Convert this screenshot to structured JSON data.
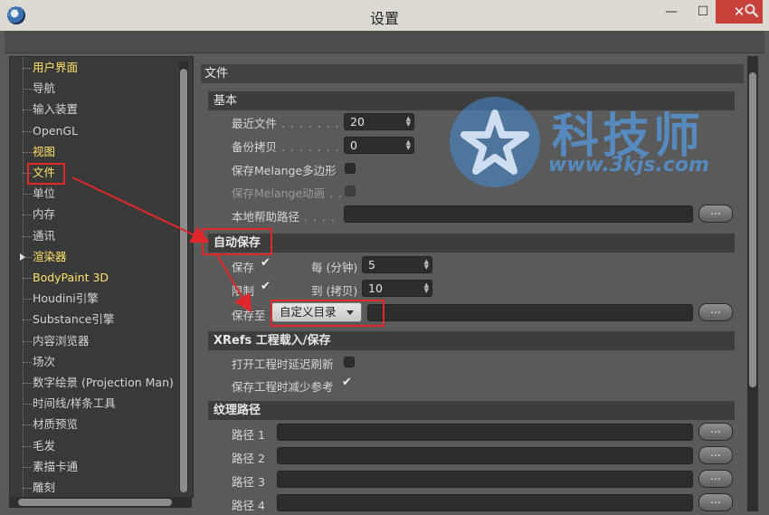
{
  "window": {
    "title": "设置",
    "min_glyph": "—",
    "max_glyph": "☐",
    "close_glyph": "✕"
  },
  "nav": {
    "items": [
      {
        "label": "用户界面",
        "highlight": true
      },
      {
        "label": "导航",
        "highlight": false
      },
      {
        "label": "输入装置",
        "highlight": false
      },
      {
        "label": "OpenGL",
        "highlight": false
      },
      {
        "label": "视图",
        "highlight": true
      },
      {
        "label": "文件",
        "highlight": true
      },
      {
        "label": "单位",
        "highlight": false
      },
      {
        "label": "内存",
        "highlight": false
      },
      {
        "label": "通讯",
        "highlight": false
      },
      {
        "label": "渲染器",
        "highlight": true,
        "expandable": true
      },
      {
        "label": "BodyPaint 3D",
        "highlight": true
      },
      {
        "label": "Houdini引擎",
        "highlight": false
      },
      {
        "label": "Substance引擎",
        "highlight": false
      },
      {
        "label": "内容浏览器",
        "highlight": false
      },
      {
        "label": "场次",
        "highlight": false
      },
      {
        "label": "数字绘景 (Projection Man)",
        "highlight": false
      },
      {
        "label": "时间线/样条工具",
        "highlight": false
      },
      {
        "label": "材质预览",
        "highlight": false
      },
      {
        "label": "毛发",
        "highlight": false
      },
      {
        "label": "素描卡通",
        "highlight": false
      },
      {
        "label": "雕刻",
        "highlight": false
      }
    ]
  },
  "main": {
    "section_title": "文件",
    "basic": {
      "title": "基本",
      "recent_files_label": "最近文件",
      "recent_files_value": "20",
      "backup_label": "备份拷贝",
      "backup_value": "0",
      "save_melange_poly_label": "保存Melange多边形",
      "save_melange_anim_label": "保存Melange动画",
      "local_help_path_label": "本地帮助路径",
      "browse_label": "..."
    },
    "autosave": {
      "title": "自动保存",
      "save_label": "保存",
      "limit_label": "限制",
      "every_label": "每 (分钟)",
      "every_value": "5",
      "to_label": "到 (拷贝)",
      "to_value": "10",
      "save_to_label": "保存至",
      "save_to_value": "自定义目录",
      "browse_label": "..."
    },
    "xrefs": {
      "title": "XRefs 工程载入/保存",
      "delay_refresh_label": "打开工程时延迟刷新",
      "reduce_refs_label": "保存工程时减少参考"
    },
    "texture": {
      "title": "纹理路径",
      "paths": [
        {
          "label": "路径 1"
        },
        {
          "label": "路径 2"
        },
        {
          "label": "路径 3"
        },
        {
          "label": "路径 4"
        }
      ],
      "browse_label": "..."
    }
  },
  "watermark": {
    "title": "科技师",
    "url": "www.3kjs.com"
  },
  "colors": {
    "highlight_text": "#ffe36b",
    "annotation_red": "#e0282b",
    "close_button": "#c7413a"
  },
  "icons": [
    "app-icon",
    "grip-icon",
    "search-icon",
    "expand-arrow-icon",
    "check-icon",
    "spin-arrows-icon",
    "dropdown-arrow-icon"
  ]
}
